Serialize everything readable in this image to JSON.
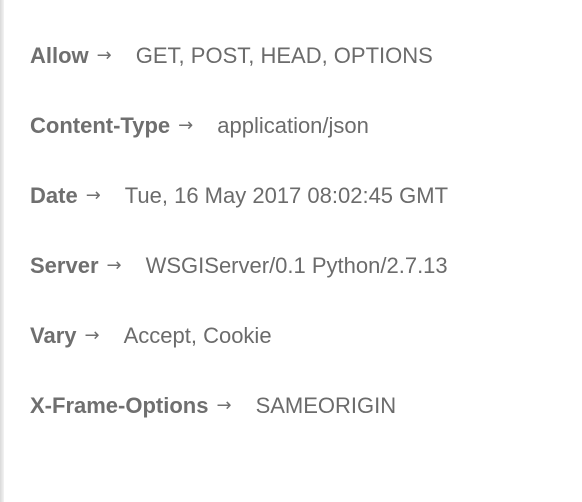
{
  "response_headers": [
    {
      "name": "Allow",
      "value": "GET, POST, HEAD, OPTIONS"
    },
    {
      "name": "Content-Type",
      "value": "application/json"
    },
    {
      "name": "Date",
      "value": "Tue, 16 May 2017 08:02:45 GMT"
    },
    {
      "name": "Server",
      "value": "WSGIServer/0.1 Python/2.7.13"
    },
    {
      "name": "Vary",
      "value": "Accept, Cookie"
    },
    {
      "name": "X-Frame-Options",
      "value": "SAMEORIGIN"
    }
  ],
  "separator": "→",
  "icons": {
    "separator": "right-arrow-icon"
  }
}
